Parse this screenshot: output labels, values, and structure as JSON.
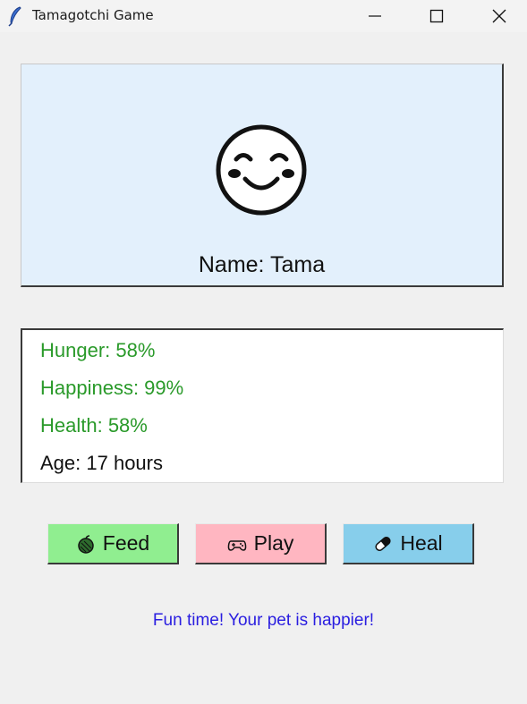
{
  "window": {
    "title": "Tamagotchi Game",
    "icon": "feather-icon"
  },
  "pet": {
    "face_icon": "smiling-face-icon",
    "name_label": "Name: Tama",
    "panel_color": "#e3f0fc"
  },
  "stats": {
    "hunger": "Hunger: 58%",
    "happiness": "Happiness: 99%",
    "health": "Health: 58%",
    "age": "Age: 17 hours",
    "good_color": "#2a9a2a"
  },
  "buttons": {
    "feed": {
      "label": "Feed",
      "icon": "apple-icon",
      "color": "#90ee90"
    },
    "play": {
      "label": "Play",
      "icon": "gamepad-icon",
      "color": "#ffb6c1"
    },
    "heal": {
      "label": "Heal",
      "icon": "pill-icon",
      "color": "#87ceeb"
    }
  },
  "status": {
    "message": "Fun time! Your pet is happier!",
    "color": "#2a1ee0"
  }
}
